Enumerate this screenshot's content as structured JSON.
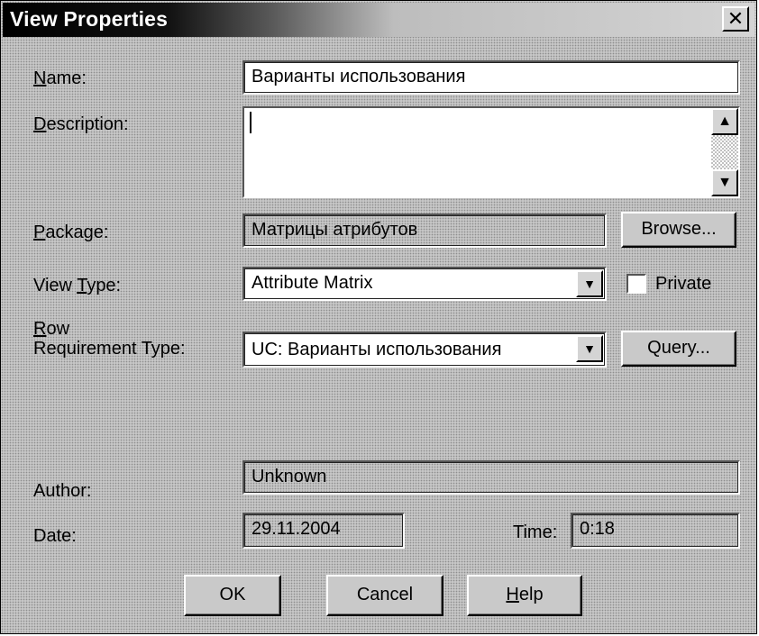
{
  "window": {
    "title": "View Properties",
    "close_glyph": "✕"
  },
  "labels": {
    "name": "Name:",
    "description": "Description:",
    "package": "Package:",
    "view_type": "View Type:",
    "row_line1": "Row",
    "row_line2": "Requirement Type:",
    "author": "Author:",
    "date": "Date:",
    "time": "Time:"
  },
  "fields": {
    "name_value": "Варианты использования",
    "description_value": "",
    "package_value": "Матрицы атрибутов",
    "view_type_value": "Attribute Matrix",
    "row_requirement_value": "UC: Варианты использования",
    "author_value": "Unknown",
    "date_value": "29.11.2004",
    "time_value": "0:18"
  },
  "checkbox": {
    "private_label": "Private",
    "private_checked": false
  },
  "buttons": {
    "browse": "Browse...",
    "query": "Query...",
    "ok": "OK",
    "cancel": "Cancel",
    "help": "Help"
  },
  "icons": {
    "close": "close-icon",
    "dropdown": "chevron-down-icon",
    "scroll_up": "arrow-up-icon",
    "scroll_down": "arrow-down-icon"
  }
}
